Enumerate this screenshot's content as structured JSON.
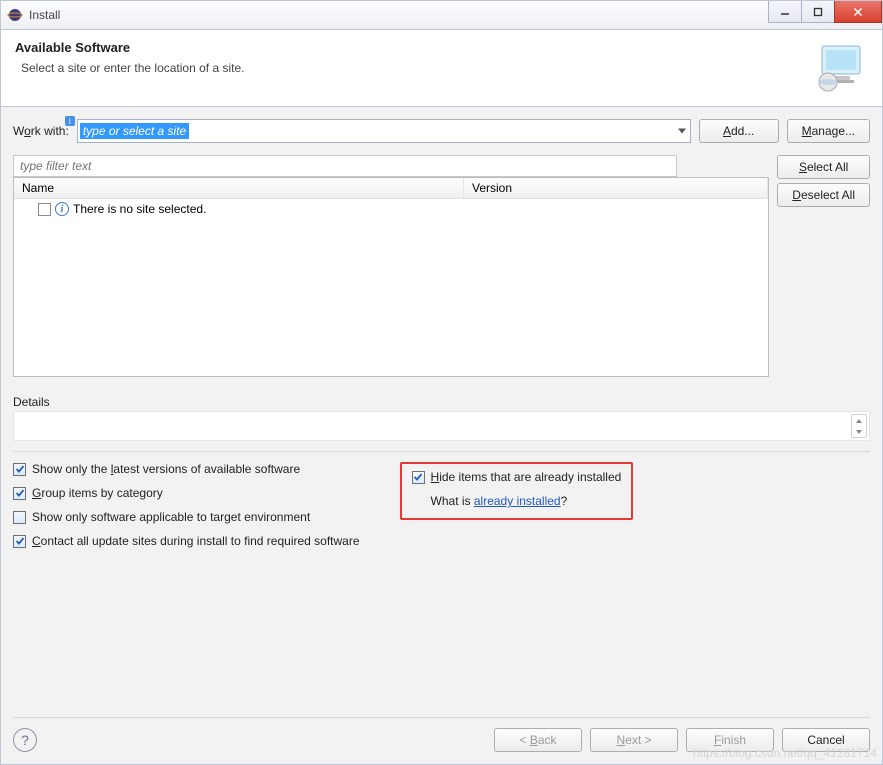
{
  "window": {
    "title": "Install"
  },
  "header": {
    "title": "Available Software",
    "subtitle": "Select a site or enter the location of a site."
  },
  "workWith": {
    "label_pre": "W",
    "label_u": "o",
    "label_post": "rk with:",
    "placeholder": "type or select a site",
    "add_u": "A",
    "add_post": "dd...",
    "manage_u": "M",
    "manage_post": "anage..."
  },
  "filter": {
    "placeholder": "type filter text"
  },
  "tree": {
    "col_name": "Name",
    "col_version": "Version",
    "empty_msg": "There is no site selected."
  },
  "selectAll": {
    "u": "S",
    "post": "elect All"
  },
  "deselectAll": {
    "u": "D",
    "post": "eselect All"
  },
  "details": {
    "label": "Details"
  },
  "options": {
    "latest_pre": "Show only the ",
    "latest_u": "l",
    "latest_post": "atest versions of available software",
    "group_u": "G",
    "group_post": "roup items by category",
    "applicable": "Show only software applicable to target environment",
    "contact_u": "C",
    "contact_post": "ontact all update sites during install to find required software",
    "hide_u": "H",
    "hide_post": "ide items that are already installed",
    "whatis_pre": "What is ",
    "whatis_link": "already installed",
    "whatis_post": "?"
  },
  "footer": {
    "back_pre": "< ",
    "back_u": "B",
    "back_post": "ack",
    "next_u": "N",
    "next_post": "ext >",
    "finish_u": "F",
    "finish_post": "inish",
    "cancel": "Cancel"
  },
  "watermark": "https://blog.csdn.net/qq_41281714"
}
